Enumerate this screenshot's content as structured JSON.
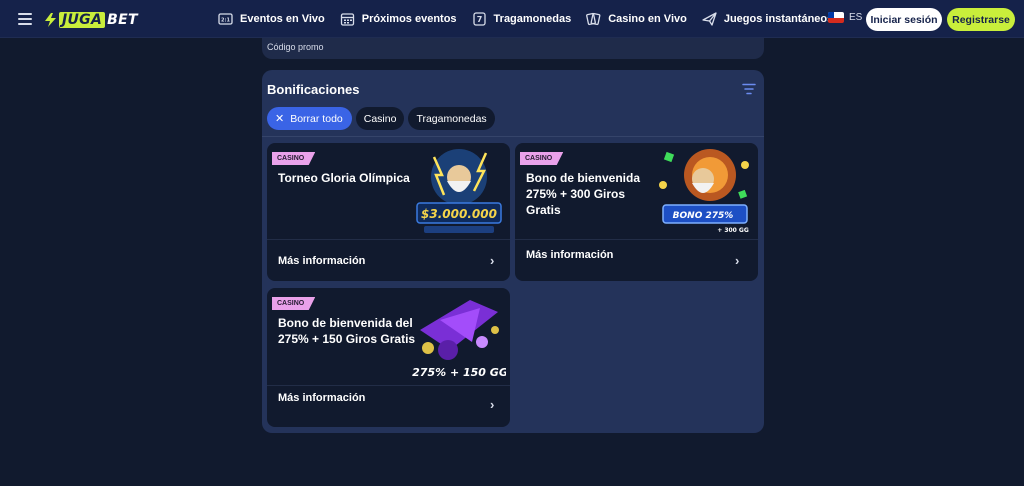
{
  "nav": {
    "brand_part1": "JUGA",
    "brand_part2": "BET",
    "items": [
      {
        "label": "Eventos en Vivo",
        "icon": "live-events-icon"
      },
      {
        "label": "Próximos eventos",
        "icon": "calendar-icon"
      },
      {
        "label": "Tragamonedas",
        "icon": "slot-machine-icon"
      },
      {
        "label": "Casino en Vivo",
        "icon": "cards-icon"
      },
      {
        "label": "Juegos instantáneos",
        "icon": "plane-icon"
      }
    ],
    "language": "ES",
    "login_label": "Iniciar sesión",
    "register_label": "Registrarse"
  },
  "promo": {
    "label": "Código promo"
  },
  "bonuses": {
    "title": "Bonificaciones",
    "chips": [
      "Borrar todo",
      "Casino",
      "Tragamonedas"
    ],
    "cards": [
      {
        "badge": "CASINO",
        "title": "Torneo Gloria Olímpica",
        "art_text": "$3.000.000",
        "more": "Más información"
      },
      {
        "badge": "CASINO",
        "title": "Bono de bienvenida 275% + 300 Giros Gratis",
        "art_text": "BONO 275%",
        "art_subtext": "+ 300 GG",
        "more": "Más información"
      },
      {
        "badge": "CASINO",
        "title": "Bono de bienvenida del 275% + 150 Giros Gratis",
        "art_text": "275% + 150 GG",
        "more": "Más información"
      }
    ]
  },
  "colors": {
    "accent": "#c9ee3b",
    "primary_blue": "#3a64e6",
    "badge": "#e9a1ea",
    "nav_bg": "#15224a",
    "panel_bg": "#24335a",
    "card_bg": "#111a2e"
  }
}
